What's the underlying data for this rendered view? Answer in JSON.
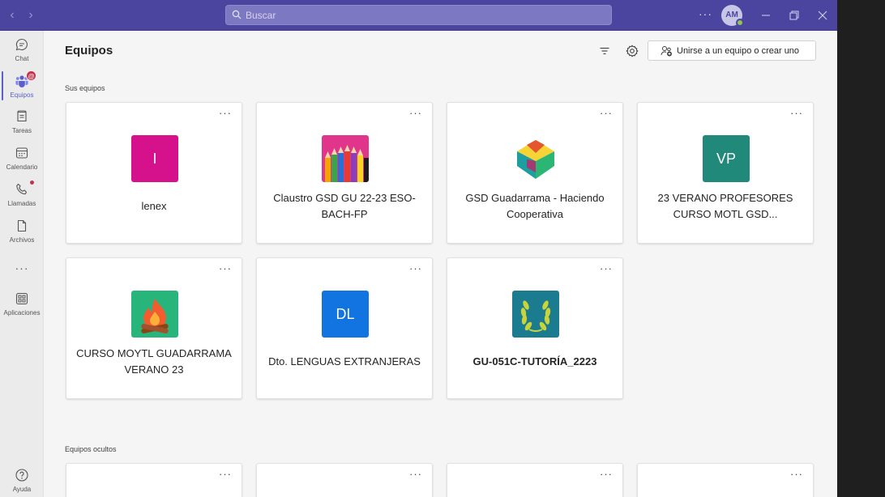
{
  "titlebar": {
    "search_placeholder": "Buscar",
    "avatar_initials": "AM",
    "more_label": "···"
  },
  "rail": {
    "items": [
      {
        "label": "Chat",
        "icon": "chat-icon"
      },
      {
        "label": "Equipos",
        "icon": "teams-icon",
        "badge": "@"
      },
      {
        "label": "Tareas",
        "icon": "assignments-icon"
      },
      {
        "label": "Calendario",
        "icon": "calendar-icon"
      },
      {
        "label": "Llamadas",
        "icon": "calls-icon"
      },
      {
        "label": "Archivos",
        "icon": "files-icon"
      },
      {
        "label": "Aplicaciones",
        "icon": "apps-icon"
      },
      {
        "label": "Ayuda",
        "icon": "help-icon"
      }
    ],
    "more_label": "···"
  },
  "main": {
    "title": "Equipos",
    "join_label": "Unirse a un equipo o crear uno",
    "section_your_teams": "Sus equipos",
    "section_hidden_teams": "Equipos ocultos",
    "card_more": "···",
    "teams": [
      {
        "name": "lenex",
        "tile_text": "I",
        "tile_color": "#d6118c"
      },
      {
        "name": "Claustro GSD GU 22-23 ESO-BACH-FP",
        "tile_text": "",
        "tile_color": "#e0358a"
      },
      {
        "name": "GSD Guadarrama - Haciendo Cooperativa",
        "tile_text": "",
        "tile_color": "#ffffff"
      },
      {
        "name": "23 VERANO PROFESORES CURSO MOTL GSD...",
        "tile_text": "VP",
        "tile_color": "#20897a"
      },
      {
        "name": "CURSO MOYTL GUADARRAMA VERANO 23",
        "tile_text": "",
        "tile_color": "#27b57c"
      },
      {
        "name": "Dto. LENGUAS EXTRANJERAS",
        "tile_text": "DL",
        "tile_color": "#1174e0"
      },
      {
        "name": "GU-051C-TUTORÍA_2223",
        "tile_text": "",
        "tile_color": "#1b7b8f"
      }
    ]
  }
}
